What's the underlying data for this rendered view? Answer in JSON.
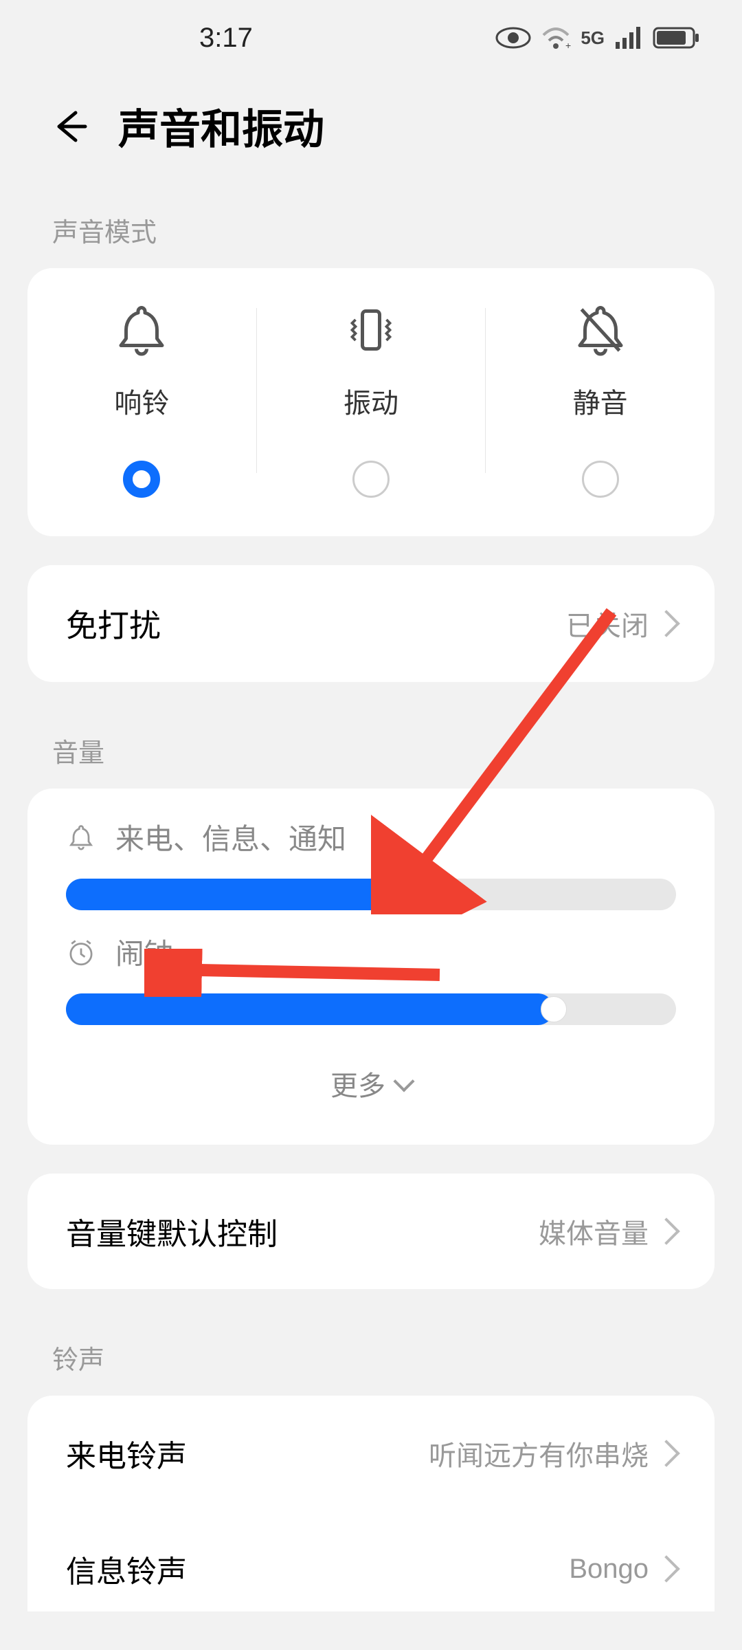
{
  "status": {
    "time": "3:17",
    "icons": {
      "network": "5G"
    }
  },
  "header": {
    "title": "声音和振动"
  },
  "sections": {
    "sound_mode_label": "声音模式",
    "modes": {
      "ring": "响铃",
      "vibrate": "振动",
      "mute": "静音",
      "selected": "ring"
    },
    "dnd": {
      "title": "免打扰",
      "value": "已关闭"
    },
    "volume_label": "音量",
    "vol_ring": {
      "label": "来电、信息、通知",
      "percent": 55
    },
    "vol_alarm": {
      "label": "闹钟",
      "percent": 80
    },
    "more": "更多",
    "vol_key": {
      "title": "音量键默认控制",
      "value": "媒体音量"
    },
    "ringtone_label": "铃声",
    "ringtone_call": {
      "title": "来电铃声",
      "value": "听闻远方有你串烧"
    },
    "ringtone_msg": {
      "title": "信息铃声",
      "value": "Bongo"
    }
  },
  "colors": {
    "accent": "#0d6efd",
    "arrow": "#f04030"
  }
}
